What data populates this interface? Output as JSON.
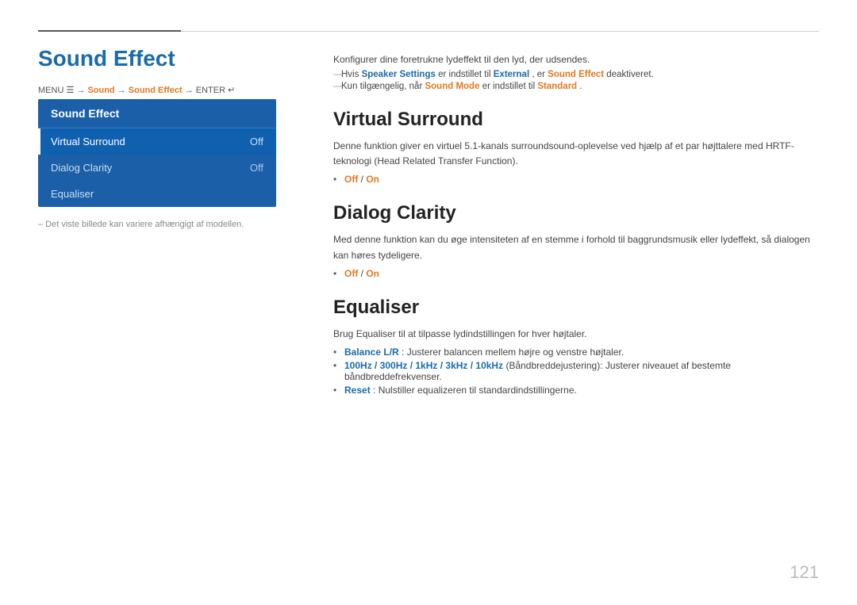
{
  "topbar": {},
  "page": {
    "title": "Sound Effect",
    "page_number": "121"
  },
  "breadcrumb": {
    "menu_label": "MENU",
    "arrow1": " → ",
    "sound": "Sound",
    "arrow2": " → ",
    "sound_effect": "Sound Effect",
    "arrow3": " → ",
    "enter": "ENTER"
  },
  "left_panel": {
    "menu_header": "Sound Effect",
    "items": [
      {
        "label": "Virtual Surround",
        "value": "Off",
        "active": true
      },
      {
        "label": "Dialog Clarity",
        "value": "Off",
        "active": false
      },
      {
        "label": "Equaliser",
        "value": "",
        "active": false
      }
    ],
    "footnote": "– Det viste billede kan variere afhængigt af modellen."
  },
  "right_panel": {
    "intro": "Konfigurer dine foretrukne lydeffekt til den lyd, der udsendes.",
    "note1_pre": "Hvis ",
    "note1_bold1": "Speaker Settings",
    "note1_mid": " er indstillet til ",
    "note1_bold2": "External",
    "note1_post": ", er ",
    "note1_bold3": "Sound Effect",
    "note1_end": " deaktiveret.",
    "note2_pre": "Kun tilgængelig, når ",
    "note2_bold1": "Sound Mode",
    "note2_mid": " er indstillet til ",
    "note2_bold2": "Standard",
    "note2_end": ".",
    "virtual_surround": {
      "title": "Virtual Surround",
      "body": "Denne funktion giver en virtuel 5.1-kanals surroundsound-oplevelse ved hjælp af et par højttalere med HRTF-teknologi (Head Related Transfer Function).",
      "bullet": "Off / On"
    },
    "dialog_clarity": {
      "title": "Dialog Clarity",
      "body": "Med denne funktion kan du øge intensiteten af en stemme i forhold til baggrundsmusik eller lydeffekt, så dialogen kan høres tydeligere.",
      "bullet": "Off / On"
    },
    "equaliser": {
      "title": "Equaliser",
      "body_pre": "Brug ",
      "body_bold": "Equaliser",
      "body_post": " til at tilpasse lydindstillingen for hver højtaler.",
      "bullet1_bold": "Balance L/R",
      "bullet1_post": ": Justerer balancen mellem højre og venstre højtaler.",
      "bullet2_bold": "100Hz / 300Hz / 1kHz / 3kHz / 10kHz",
      "bullet2_post": " (Båndbreddejustering): Justerer niveauet af bestemte båndbreddefrekvenser.",
      "bullet3_bold": "Reset",
      "bullet3_post": ": Nulstiller equalizeren til standardindstillingerne."
    }
  }
}
